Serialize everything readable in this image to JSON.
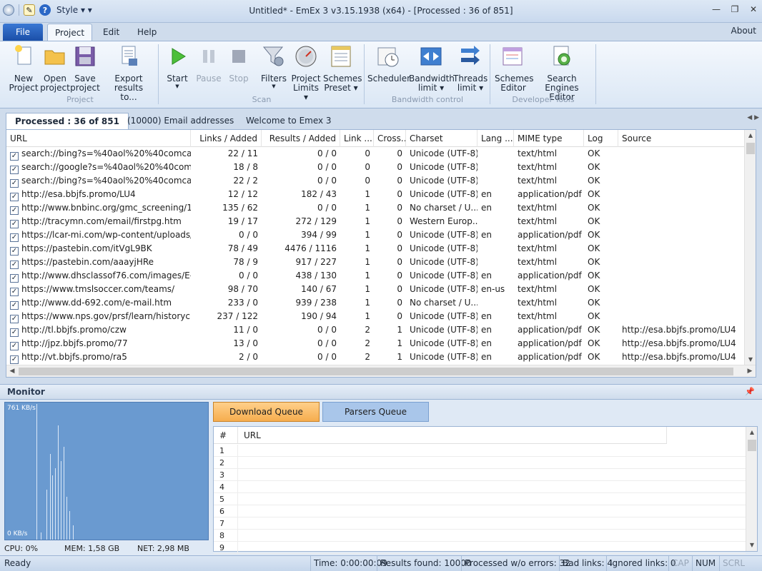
{
  "window": {
    "title": "Untitled* - EmEx 3 v3.15.1938 (x64) - [Processed : 36 of 851]",
    "style_label": "Style",
    "controls": [
      "—",
      "❐",
      "✕"
    ]
  },
  "menu": {
    "file": "File",
    "tabs": [
      "Project",
      "Edit",
      "Help"
    ],
    "about": "About"
  },
  "ribbon": {
    "groups": [
      {
        "name": "Project",
        "buttons": [
          {
            "label1": "New",
            "label2": "Project"
          },
          {
            "label1": "Open",
            "label2": "project"
          },
          {
            "label1": "Save",
            "label2": "project"
          },
          {
            "label1": "Export results",
            "label2": "to..."
          }
        ]
      },
      {
        "name": "Scan",
        "buttons": [
          {
            "label1": "Start",
            "label2": ""
          },
          {
            "label1": "Pause",
            "label2": ""
          },
          {
            "label1": "Stop",
            "label2": ""
          },
          {
            "label1": "Filters",
            "label2": ""
          },
          {
            "label1": "Project",
            "label2": "Limits"
          },
          {
            "label1": "Schemes",
            "label2": "Preset"
          }
        ]
      },
      {
        "name": "Bandwidth control",
        "buttons": [
          {
            "label1": "Scheduler",
            "label2": ""
          },
          {
            "label1": "Bandwidth",
            "label2": "limit"
          },
          {
            "label1": "Threads",
            "label2": "limit"
          }
        ]
      },
      {
        "name": "Developer Tools",
        "buttons": [
          {
            "label1": "Schemes",
            "label2": "Editor"
          },
          {
            "label1": "Search Engines",
            "label2": "Editor"
          }
        ]
      }
    ]
  },
  "doc_tabs": [
    "Processed : 36 of 851",
    "(10000) Email addresses",
    "Welcome to Emex 3"
  ],
  "grid": {
    "columns": [
      "URL",
      "Links / Added",
      "Results / Added",
      "Link ...",
      "Cross...",
      "Charset",
      "Lang ...",
      "MIME type",
      "Log",
      "Source"
    ],
    "rows": [
      [
        "search://bing?s=%40aol%20%40comcast...",
        "22 / 11",
        "0 / 0",
        "0",
        "0",
        "Unicode (UTF-8)",
        "",
        "text/html",
        "OK",
        ""
      ],
      [
        "search://google?s=%40aol%20%40comca...",
        "18 / 8",
        "0 / 0",
        "0",
        "0",
        "Unicode (UTF-8)",
        "",
        "text/html",
        "OK",
        ""
      ],
      [
        "search://bing?s=%40aol%20%40comcast...",
        "22 / 2",
        "0 / 0",
        "0",
        "0",
        "Unicode (UTF-8)",
        "",
        "text/html",
        "OK",
        ""
      ],
      [
        "http://esa.bbjfs.promo/LU4",
        "12 / 12",
        "182 / 43",
        "1",
        "0",
        "Unicode (UTF-8)",
        "en",
        "application/pdf",
        "OK",
        ""
      ],
      [
        "http://www.bnbinc.org/gmc_screening/1...",
        "135 / 62",
        "0 / 0",
        "1",
        "0",
        "No charset / U...",
        "en",
        "text/html",
        "OK",
        ""
      ],
      [
        "http://tracymn.com/email/firstpg.htm",
        "19 / 17",
        "272 / 129",
        "1",
        "0",
        "Western Europ...",
        "",
        "text/html",
        "OK",
        ""
      ],
      [
        "https://lcar-mi.com/wp-content/uploads/...",
        "0 / 0",
        "394 / 99",
        "1",
        "0",
        "Unicode (UTF-8)",
        "en",
        "application/pdf",
        "OK",
        ""
      ],
      [
        "https://pastebin.com/itVgL9BK",
        "78 / 49",
        "4476 / 1116",
        "1",
        "0",
        "Unicode (UTF-8)",
        "",
        "text/html",
        "OK",
        ""
      ],
      [
        "https://pastebin.com/aaayjHRe",
        "78 / 9",
        "917 / 227",
        "1",
        "0",
        "Unicode (UTF-8)",
        "",
        "text/html",
        "OK",
        ""
      ],
      [
        "http://www.dhsclassof76.com/images/E-...",
        "0 / 0",
        "438 / 130",
        "1",
        "0",
        "Unicode (UTF-8)",
        "en",
        "application/pdf",
        "OK",
        ""
      ],
      [
        "https://www.tmslsoccer.com/teams/",
        "98 / 70",
        "140 / 67",
        "1",
        "0",
        "Unicode (UTF-8)",
        "en-us",
        "text/html",
        "OK",
        ""
      ],
      [
        "http://www.dd-692.com/e-mail.htm",
        "233 / 0",
        "939 / 238",
        "1",
        "0",
        "No charset / U...",
        "",
        "text/html",
        "OK",
        ""
      ],
      [
        "https://www.nps.gov/prsf/learn/historycu...",
        "237 / 122",
        "190 / 94",
        "1",
        "0",
        "Unicode (UTF-8)",
        "en",
        "text/html",
        "OK",
        ""
      ],
      [
        "http://tl.bbjfs.promo/czw",
        "11 / 0",
        "0 / 0",
        "2",
        "1",
        "Unicode (UTF-8)",
        "en",
        "application/pdf",
        "OK",
        "http://esa.bbjfs.promo/LU4"
      ],
      [
        "http://jpz.bbjfs.promo/77",
        "13 / 0",
        "0 / 0",
        "2",
        "1",
        "Unicode (UTF-8)",
        "en",
        "application/pdf",
        "OK",
        "http://esa.bbjfs.promo/LU4"
      ],
      [
        "http://vt.bbjfs.promo/ra5",
        "2 / 0",
        "0 / 0",
        "2",
        "1",
        "Unicode (UTF-8)",
        "en",
        "application/pdf",
        "OK",
        "http://esa.bbjfs.promo/LU4"
      ]
    ]
  },
  "monitor": {
    "title": "Monitor",
    "graph_max": "761 KB/s",
    "graph_min": "0 KB/s",
    "cpu": "CPU: 0%",
    "mem": "MEM: 1,58 GB",
    "net": "NET: 2,98 MB",
    "queue_tabs": [
      "Download Queue",
      "Parsers Queue"
    ],
    "queue_columns": [
      "#",
      "URL"
    ],
    "queue_rows": [
      "1",
      "2",
      "3",
      "4",
      "5",
      "6",
      "7",
      "8",
      "9"
    ]
  },
  "status": {
    "ready": "Ready",
    "time": "Time: 0:00:00:09",
    "results": "Results found: 10000",
    "processed": "Processed w/o errors: 32",
    "bad": "Bad links: 4",
    "ignored": "Ignored links: 0",
    "cap": "CAP",
    "num": "NUM",
    "scrl": "SCRL"
  }
}
